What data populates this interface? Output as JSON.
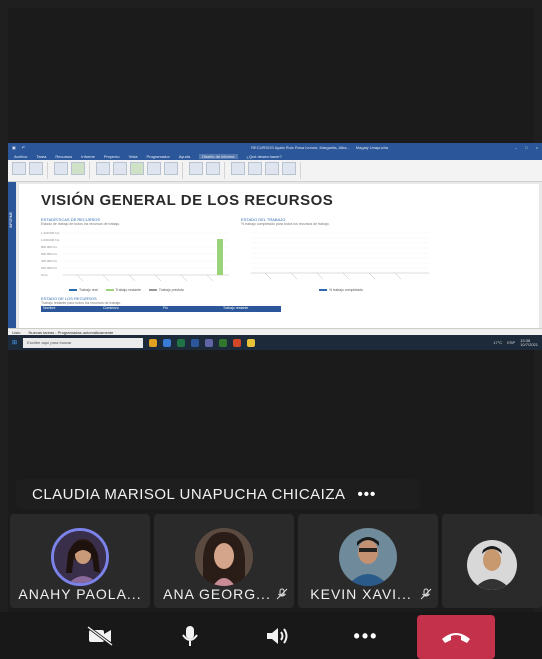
{
  "shared_screen": {
    "window_title": "RECURSOS Ayala Ruiz Rosa Ivonne, Margarita, Alba...",
    "window_user": "Magaly Unapucha",
    "ribbon_tabs": [
      "Archivo",
      "Tarea",
      "Recursos",
      "Informe",
      "Proyecto",
      "Vista",
      "Programador",
      "Ayuda",
      "Diseño de informe",
      "¿Qué desea hacer?"
    ],
    "active_tab": "Diseño de informe",
    "report": {
      "title": "VISIÓN GENERAL DE LOS RECURSOS",
      "stats_header": "ESTADÍSTICAS DE RECURSOS",
      "stats_desc": "Estado de trabajo de todos los recursos de trabajo.",
      "work_status_header": "ESTADO DEL TRABAJO",
      "work_status_desc": "% trabajo completado para todos los recursos de trabajo.",
      "resource_status_header": "ESTADO DE LOS RECURSOS",
      "resource_status_desc": "Trabajo restante para todos los recursos de trabajo.",
      "table_columns": [
        "Nombre",
        "Comienzo",
        "Fin",
        "Trabajo restante"
      ],
      "left_legend": [
        "Trabajo real",
        "Trabajo restante",
        "Trabajo previsto"
      ],
      "right_legend": "% trabajo completado",
      "left_y_ticks": [
        "1.200.000 hrs",
        "1.000.000 hrs",
        "800.000 hrs",
        "600.000 hrs",
        "400.000 hrs",
        "200.000 hrs",
        "0 hrs"
      ]
    },
    "status_bar": {
      "left": "Listo",
      "mode": "Nuevas tareas : Programadas automáticamente"
    },
    "taskbar": {
      "search_placeholder": "Escribe aquí para buscar",
      "weather": "17°C",
      "language": "ESP",
      "time": "13:38",
      "date": "10/7/2021"
    }
  },
  "speaker": {
    "name": "CLAUDIA MARISOL UNAPUCHA CHICAIZA",
    "more": "•••"
  },
  "participants": [
    {
      "name": "ANAHY PAOLA...",
      "muted": false
    },
    {
      "name": "ANA GEORG...",
      "muted": true
    },
    {
      "name": "KEVIN XAVI...",
      "muted": true
    },
    {
      "name": "",
      "muted": false
    }
  ],
  "controls": {
    "more": "•••"
  },
  "colors": {
    "hangup": "#c4314b",
    "ribbon": "#2b579a",
    "bar_green": "#9bd37a"
  }
}
